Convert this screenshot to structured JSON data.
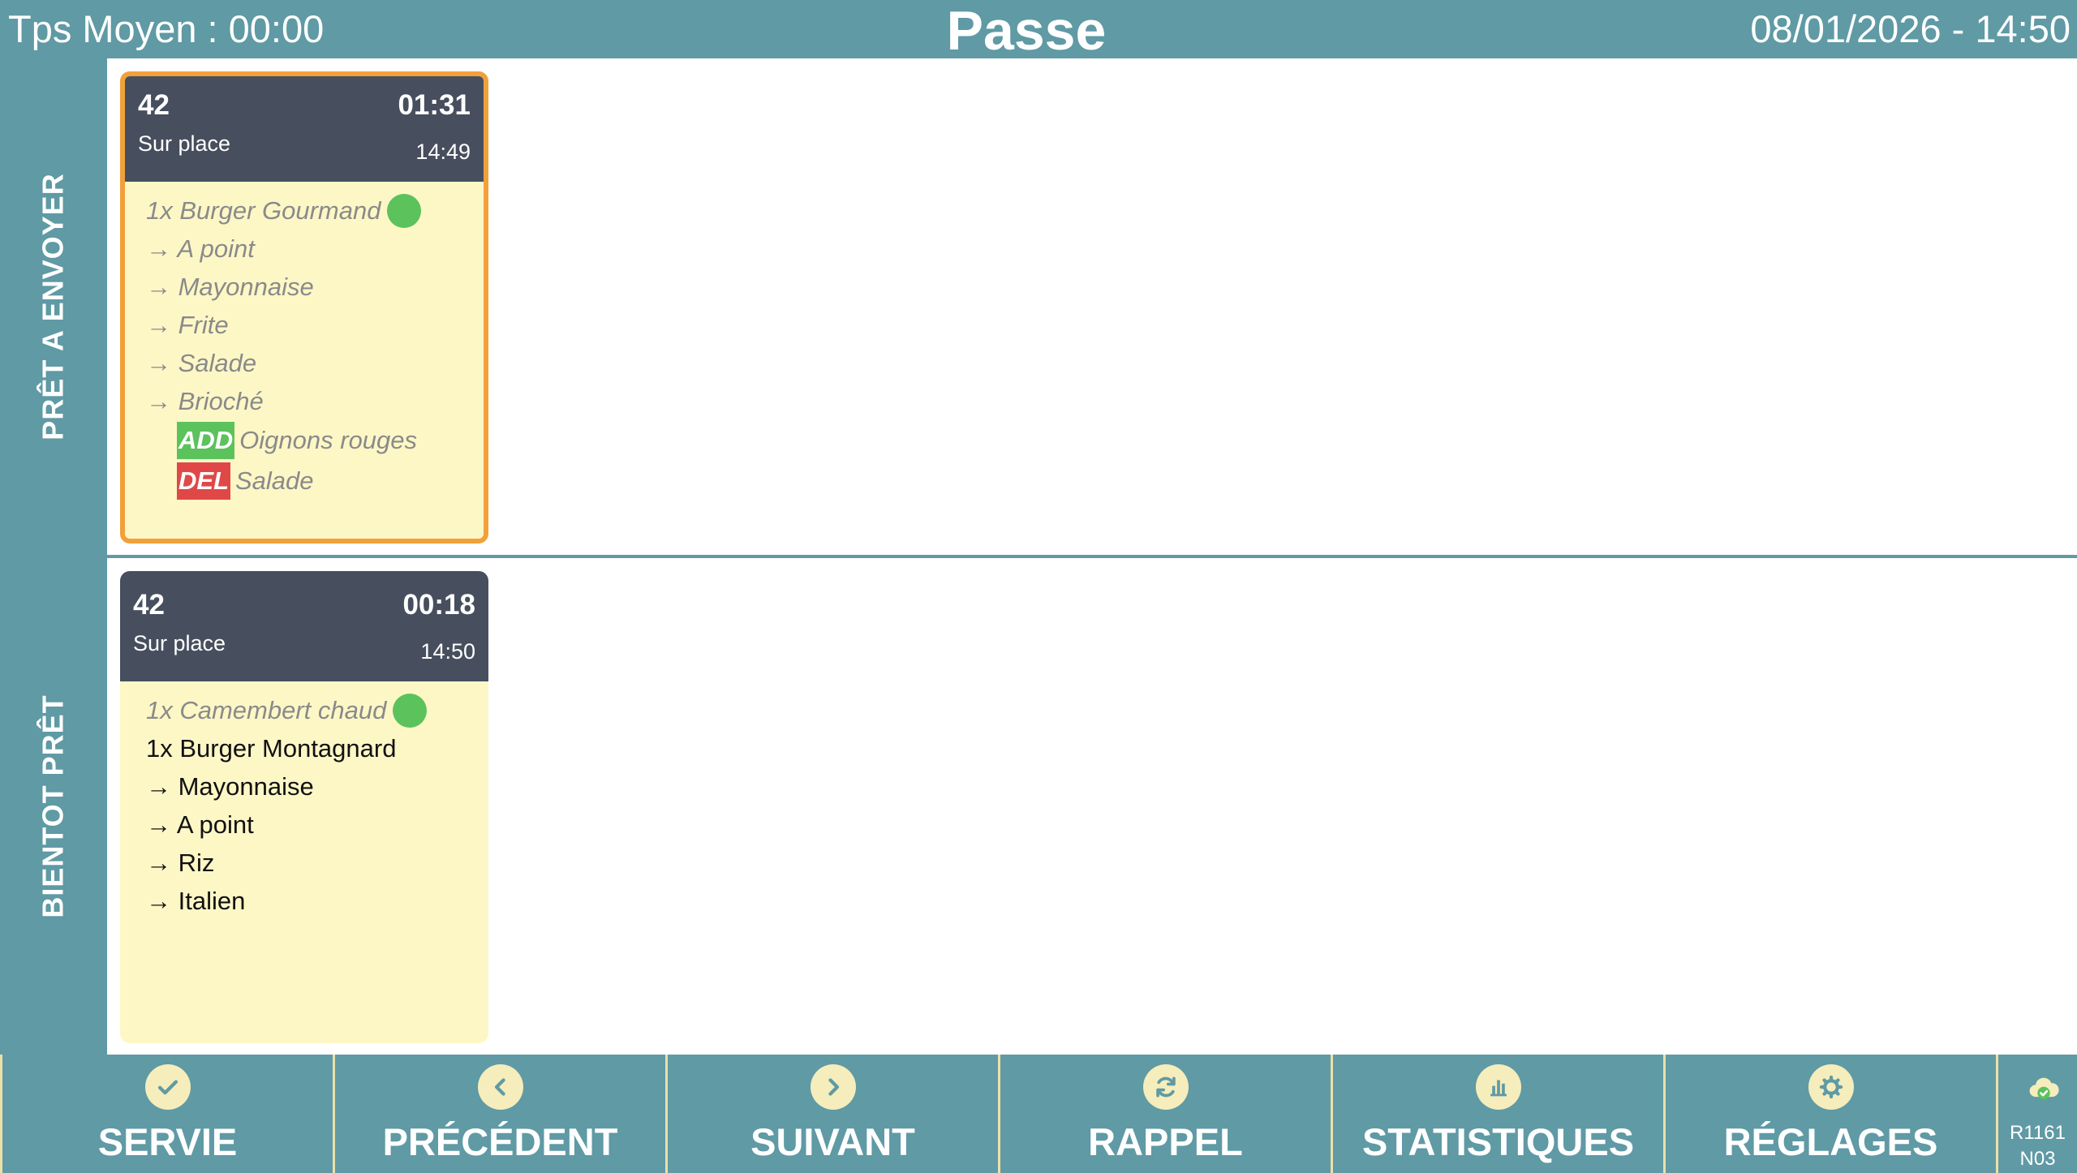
{
  "header": {
    "average_time": "Tps Moyen : 00:00",
    "title": "Passe",
    "datetime": "08/01/2026 - 14:50"
  },
  "sections": [
    {
      "label": "PRÊT A ENVOYER",
      "ticket": {
        "number": "42",
        "elapsed": "01:31",
        "mode": "Sur place",
        "time": "14:49",
        "lines": [
          {
            "text": "1x Burger Gourmand",
            "done": true,
            "dot": true
          },
          {
            "text": "→ A point",
            "done": true
          },
          {
            "text": "→ Mayonnaise",
            "done": true
          },
          {
            "text": "→ Frite",
            "done": true
          },
          {
            "text": "→ Salade",
            "done": true
          },
          {
            "text": "→ Brioché",
            "done": true
          }
        ],
        "modifiers": [
          {
            "badge": "ADD",
            "text": "Oignons rouges"
          },
          {
            "badge": "DEL",
            "text": "Salade"
          }
        ]
      }
    },
    {
      "label": "BIENTOT PRÊT",
      "ticket": {
        "number": "42",
        "elapsed": "00:18",
        "mode": "Sur place",
        "time": "14:50",
        "lines": [
          {
            "text": "1x Camembert chaud",
            "done": true,
            "dot": true
          },
          {
            "text": "1x Burger Montagnard",
            "done": false
          },
          {
            "text": "→ Mayonnaise",
            "done": false
          },
          {
            "text": "→ A point",
            "done": false
          },
          {
            "text": "→ Riz",
            "done": false
          },
          {
            "text": "→ Italien",
            "done": false
          }
        ]
      }
    }
  ],
  "footer": {
    "buttons": [
      {
        "label": "SERVIE",
        "icon": "check-icon"
      },
      {
        "label": "PRÉCÉDENT",
        "icon": "chevron-left-icon"
      },
      {
        "label": "SUIVANT",
        "icon": "chevron-right-icon"
      },
      {
        "label": "RAPPEL",
        "icon": "refresh-icon"
      },
      {
        "label": "STATISTIQUES",
        "icon": "bar-chart-icon"
      },
      {
        "label": "RÉGLAGES",
        "icon": "gear-icon"
      }
    ],
    "status": {
      "icon": "cloud-connected-icon",
      "line1": "R1161",
      "line2": "N03"
    }
  },
  "colors": {
    "background": "#5f9aa5",
    "ticket_header": "#474f5e",
    "ticket_body": "#fdf7c6",
    "highlight_border": "#f2a03a",
    "done_dot": "#5cc25c",
    "add_badge": "#5cc25c",
    "del_badge": "#e04848"
  }
}
